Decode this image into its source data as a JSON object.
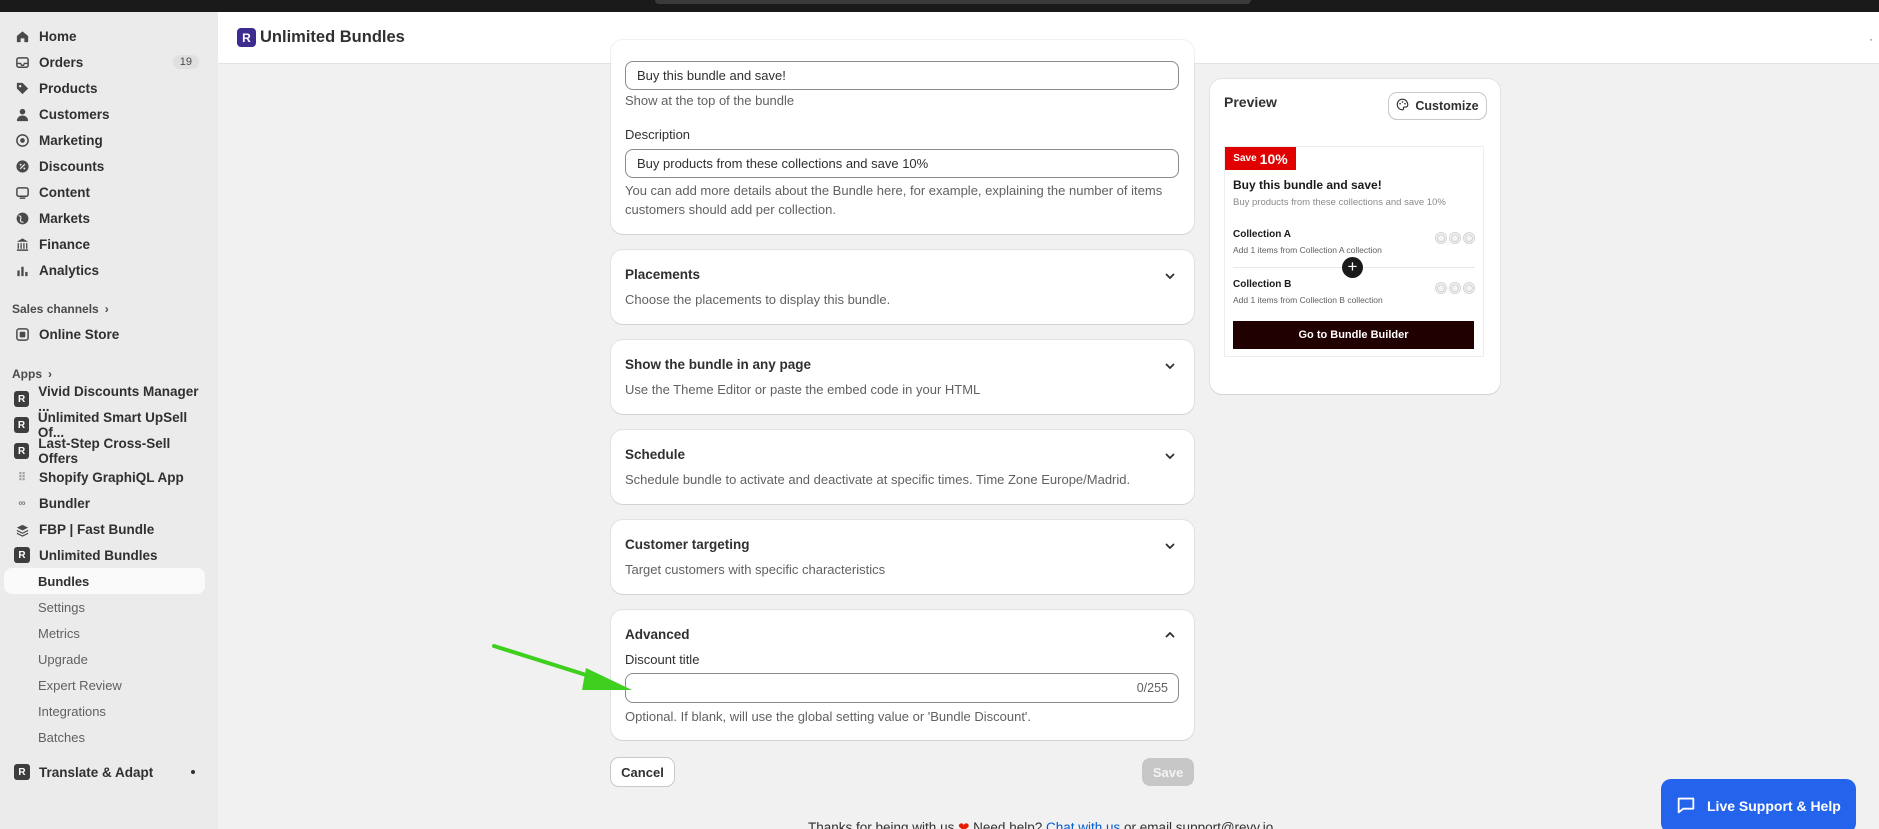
{
  "sidebar": {
    "main_items": [
      {
        "label": "Home",
        "icon": "home-icon"
      },
      {
        "label": "Orders",
        "icon": "orders-icon",
        "badge": "19"
      },
      {
        "label": "Products",
        "icon": "tag-icon"
      },
      {
        "label": "Customers",
        "icon": "person-icon"
      },
      {
        "label": "Marketing",
        "icon": "target-icon"
      },
      {
        "label": "Discounts",
        "icon": "discount-icon"
      },
      {
        "label": "Content",
        "icon": "content-icon"
      },
      {
        "label": "Markets",
        "icon": "globe-icon"
      },
      {
        "label": "Finance",
        "icon": "bank-icon"
      },
      {
        "label": "Analytics",
        "icon": "chart-icon"
      }
    ],
    "sales_channels_label": "Sales channels",
    "online_store_label": "Online Store",
    "apps_label": "Apps",
    "apps": [
      {
        "label": "Vivid Discounts Manager ..."
      },
      {
        "label": "Unlimited Smart UpSell Of..."
      },
      {
        "label": "Last-Step Cross-Sell Offers"
      },
      {
        "label": "Shopify GraphiQL App"
      },
      {
        "label": "Bundler"
      },
      {
        "label": "FBP | Fast Bundle"
      },
      {
        "label": "Unlimited Bundles"
      }
    ],
    "sub_items": [
      {
        "label": "Bundles"
      },
      {
        "label": "Settings"
      },
      {
        "label": "Metrics"
      },
      {
        "label": "Upgrade"
      },
      {
        "label": "Expert Review"
      },
      {
        "label": "Integrations"
      },
      {
        "label": "Batches"
      }
    ],
    "translate_label": "Translate & Adapt"
  },
  "appbar": {
    "title": "Unlimited Bundles"
  },
  "form": {
    "title_value": "Buy this bundle and save!",
    "title_help": "Show at the top of the bundle",
    "description_label": "Description",
    "description_value": "Buy products from these collections and save 10%",
    "description_help_1": "You can add more details about the Bundle here, for example, explaining the number of items",
    "description_help_2": "customers should add per collection.",
    "sections": [
      {
        "title": "Placements",
        "desc": "Choose the placements to display this bundle."
      },
      {
        "title": "Show the bundle in any page",
        "desc": "Use the Theme Editor or paste the embed code in your HTML"
      },
      {
        "title": "Schedule",
        "desc": "Schedule bundle to activate and deactivate at specific times. Time Zone Europe/Madrid."
      },
      {
        "title": "Customer targeting",
        "desc": "Target customers with specific characteristics"
      }
    ],
    "advanced": {
      "title": "Advanced",
      "discount_title_label": "Discount title",
      "discount_title_value": "",
      "counter": "0/255",
      "help": "Optional. If blank, will use the global setting value or 'Bundle Discount'."
    },
    "cancel_label": "Cancel",
    "save_label": "Save"
  },
  "preview": {
    "title": "Preview",
    "customize_label": "Customize",
    "save_word": "Save",
    "save_pct": "10%",
    "heading": "Buy this bundle and save!",
    "subheading": "Buy products from these collections and save 10%",
    "collections": [
      {
        "name": "Collection A",
        "desc": "Add 1 items from Collection A collection"
      },
      {
        "name": "Collection B",
        "desc": "Add 1 items from Collection B collection"
      }
    ],
    "cta": "Go to Bundle Builder"
  },
  "footer": {
    "pre": "Thanks for being with us",
    "mid": " Need help? ",
    "link": "Chat with us",
    "post": " or email support@revy.io"
  },
  "live_support": {
    "label": "Live Support & Help"
  },
  "colors": {
    "accent_red": "#e00000",
    "cta_dark": "#200000",
    "support_blue": "#2463eb",
    "arrow_green": "#3fcf1f"
  }
}
